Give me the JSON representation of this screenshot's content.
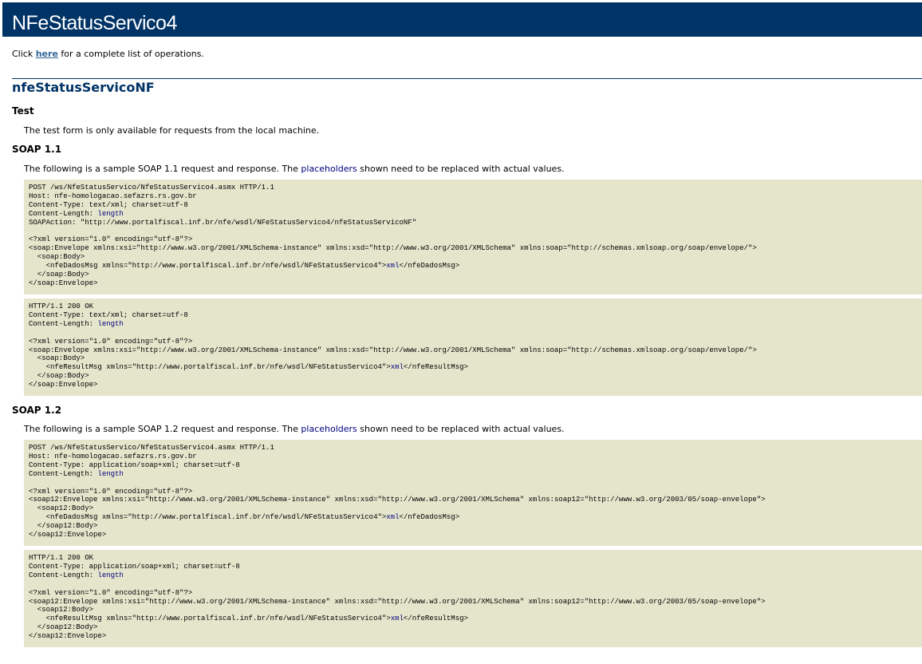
{
  "header": {
    "title": "NFeStatusServico4"
  },
  "intro": {
    "prefix": "Click ",
    "link": "here",
    "suffix": " for a complete list of operations."
  },
  "operation": {
    "name": "nfeStatusServicoNF"
  },
  "test": {
    "heading": "Test",
    "text": "The test form is only available for requests from the local machine."
  },
  "soap11": {
    "heading": "SOAP 1.1",
    "para_prefix": "The following is a sample SOAP 1.1 request and response.  The ",
    "para_link": "placeholders",
    "para_suffix": " shown need to be replaced with actual values.",
    "request": {
      "l1": "POST /ws/NfeStatusServico/NfeStatusServico4.asmx HTTP/1.1",
      "l2": "Host: nfe-homologacao.sefazrs.rs.gov.br",
      "l3": "Content-Type: text/xml; charset=utf-8",
      "l4a": "Content-Length: ",
      "l4b": "length",
      "l5": "SOAPAction: \"http://www.portalfiscal.inf.br/nfe/wsdl/NFeStatusServico4/nfeStatusServicoNF\"",
      "l7": "<?xml version=\"1.0\" encoding=\"utf-8\"?>",
      "l8": "<soap:Envelope xmlns:xsi=\"http://www.w3.org/2001/XMLSchema-instance\" xmlns:xsd=\"http://www.w3.org/2001/XMLSchema\" xmlns:soap=\"http://schemas.xmlsoap.org/soap/envelope/\">",
      "l9": "  <soap:Body>",
      "l10a": "    <nfeDadosMsg xmlns=\"http://www.portalfiscal.inf.br/nfe/wsdl/NFeStatusServico4\">",
      "l10b": "xml",
      "l10c": "</nfeDadosMsg>",
      "l11": "  </soap:Body>",
      "l12": "</soap:Envelope>"
    },
    "response": {
      "l1": "HTTP/1.1 200 OK",
      "l2": "Content-Type: text/xml; charset=utf-8",
      "l3a": "Content-Length: ",
      "l3b": "length",
      "l5": "<?xml version=\"1.0\" encoding=\"utf-8\"?>",
      "l6": "<soap:Envelope xmlns:xsi=\"http://www.w3.org/2001/XMLSchema-instance\" xmlns:xsd=\"http://www.w3.org/2001/XMLSchema\" xmlns:soap=\"http://schemas.xmlsoap.org/soap/envelope/\">",
      "l7": "  <soap:Body>",
      "l8a": "    <nfeResultMsg xmlns=\"http://www.portalfiscal.inf.br/nfe/wsdl/NFeStatusServico4\">",
      "l8b": "xml",
      "l8c": "</nfeResultMsg>",
      "l9": "  </soap:Body>",
      "l10": "</soap:Envelope>"
    }
  },
  "soap12": {
    "heading": "SOAP 1.2",
    "para_prefix": "The following is a sample SOAP 1.2 request and response.  The ",
    "para_link": "placeholders",
    "para_suffix": " shown need to be replaced with actual values.",
    "request": {
      "l1": "POST /ws/NfeStatusServico/NfeStatusServico4.asmx HTTP/1.1",
      "l2": "Host: nfe-homologacao.sefazrs.rs.gov.br",
      "l3": "Content-Type: application/soap+xml; charset=utf-8",
      "l4a": "Content-Length: ",
      "l4b": "length",
      "l6": "<?xml version=\"1.0\" encoding=\"utf-8\"?>",
      "l7": "<soap12:Envelope xmlns:xsi=\"http://www.w3.org/2001/XMLSchema-instance\" xmlns:xsd=\"http://www.w3.org/2001/XMLSchema\" xmlns:soap12=\"http://www.w3.org/2003/05/soap-envelope\">",
      "l8": "  <soap12:Body>",
      "l9a": "    <nfeDadosMsg xmlns=\"http://www.portalfiscal.inf.br/nfe/wsdl/NFeStatusServico4\">",
      "l9b": "xml",
      "l9c": "</nfeDadosMsg>",
      "l10": "  </soap12:Body>",
      "l11": "</soap12:Envelope>"
    },
    "response": {
      "l1": "HTTP/1.1 200 OK",
      "l2": "Content-Type: application/soap+xml; charset=utf-8",
      "l3a": "Content-Length: ",
      "l3b": "length",
      "l5": "<?xml version=\"1.0\" encoding=\"utf-8\"?>",
      "l6": "<soap12:Envelope xmlns:xsi=\"http://www.w3.org/2001/XMLSchema-instance\" xmlns:xsd=\"http://www.w3.org/2001/XMLSchema\" xmlns:soap12=\"http://www.w3.org/2003/05/soap-envelope\">",
      "l7": "  <soap12:Body>",
      "l8a": "    <nfeResultMsg xmlns=\"http://www.portalfiscal.inf.br/nfe/wsdl/NFeStatusServico4\">",
      "l8b": "xml",
      "l8c": "</nfeResultMsg>",
      "l9": "  </soap12:Body>",
      "l10": "</soap12:Envelope>"
    }
  },
  "colors": {
    "header_bg": "#003366",
    "code_bg": "#e5e5cc",
    "link": "#336699",
    "placeholder": "#000080"
  }
}
